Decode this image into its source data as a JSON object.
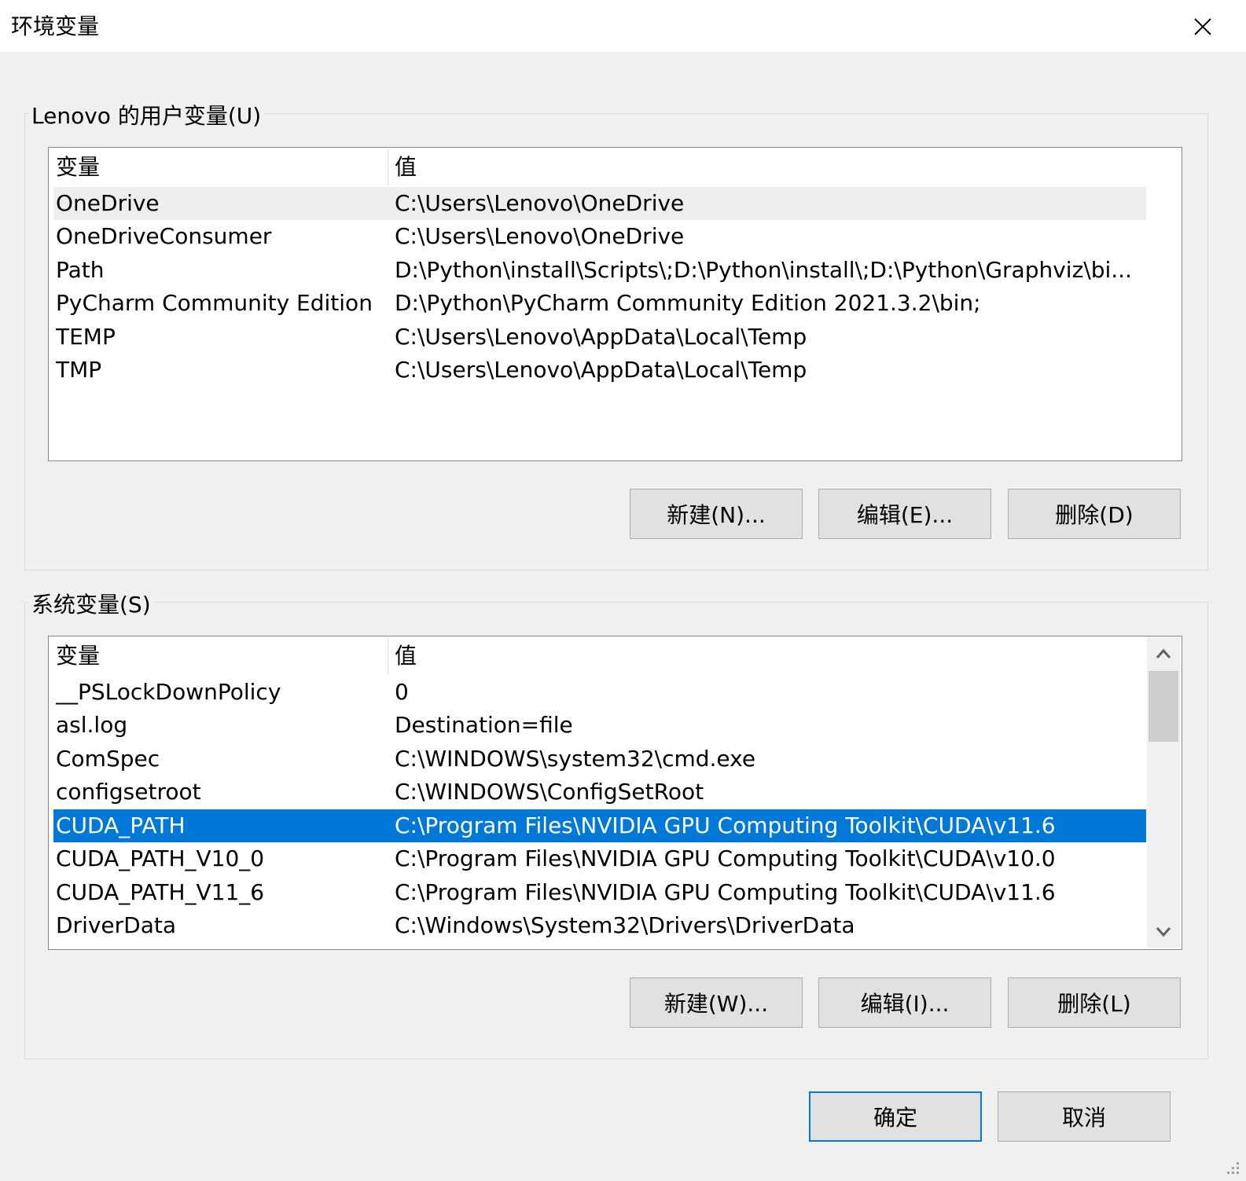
{
  "window": {
    "title": "环境变量"
  },
  "user_section": {
    "label": "Lenovo 的用户变量(U)",
    "col_var": "变量",
    "col_val": "值",
    "rows": [
      {
        "name": "OneDrive",
        "value": "C:\\Users\\Lenovo\\OneDrive"
      },
      {
        "name": "OneDriveConsumer",
        "value": "C:\\Users\\Lenovo\\OneDrive"
      },
      {
        "name": "Path",
        "value": "D:\\Python\\install\\Scripts\\;D:\\Python\\install\\;D:\\Python\\Graphviz\\bi..."
      },
      {
        "name": "PyCharm Community Edition",
        "value": "D:\\Python\\PyCharm Community Edition 2021.3.2\\bin;"
      },
      {
        "name": "TEMP",
        "value": "C:\\Users\\Lenovo\\AppData\\Local\\Temp"
      },
      {
        "name": "TMP",
        "value": "C:\\Users\\Lenovo\\AppData\\Local\\Temp"
      }
    ],
    "buttons": {
      "new": "新建(N)...",
      "edit": "编辑(E)...",
      "delete": "删除(D)"
    }
  },
  "system_section": {
    "label": "系统变量(S)",
    "col_var": "变量",
    "col_val": "值",
    "rows": [
      {
        "name": "__PSLockDownPolicy",
        "value": "0"
      },
      {
        "name": "asl.log",
        "value": "Destination=file"
      },
      {
        "name": "ComSpec",
        "value": "C:\\WINDOWS\\system32\\cmd.exe"
      },
      {
        "name": "configsetroot",
        "value": "C:\\WINDOWS\\ConfigSetRoot"
      },
      {
        "name": "CUDA_PATH",
        "value": "C:\\Program Files\\NVIDIA GPU Computing Toolkit\\CUDA\\v11.6"
      },
      {
        "name": "CUDA_PATH_V10_0",
        "value": "C:\\Program Files\\NVIDIA GPU Computing Toolkit\\CUDA\\v10.0"
      },
      {
        "name": "CUDA_PATH_V11_6",
        "value": "C:\\Program Files\\NVIDIA GPU Computing Toolkit\\CUDA\\v11.6"
      },
      {
        "name": "DriverData",
        "value": "C:\\Windows\\System32\\Drivers\\DriverData"
      }
    ],
    "buttons": {
      "new": "新建(W)...",
      "edit": "编辑(I)...",
      "delete": "删除(L)"
    }
  },
  "footer": {
    "ok": "确定",
    "cancel": "取消"
  },
  "colors": {
    "selection": "#0078d7",
    "dialog_bg": "#f0f0f0"
  }
}
